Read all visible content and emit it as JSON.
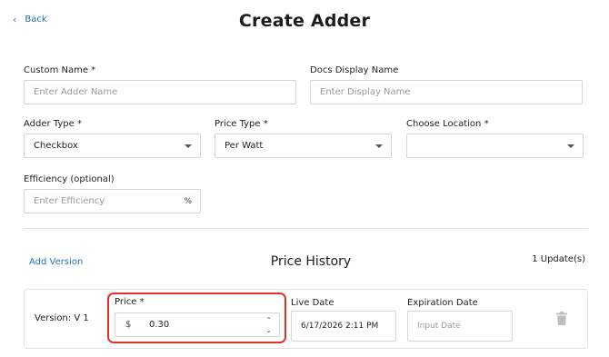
{
  "header": {
    "back_label": "Back",
    "title": "Create Adder"
  },
  "form": {
    "custom_name": {
      "label": "Custom Name *",
      "placeholder": "Enter Adder Name"
    },
    "docs_display_name": {
      "label": "Docs Display Name",
      "placeholder": "Enter Display Name"
    },
    "adder_type": {
      "label": "Adder Type *",
      "value": "Checkbox"
    },
    "price_type": {
      "label": "Price Type *",
      "value": "Per Watt"
    },
    "choose_location": {
      "label": "Choose Location *",
      "value": ""
    },
    "efficiency": {
      "label": "Efficiency (optional)",
      "placeholder": "Enter Efficiency",
      "suffix": "%"
    }
  },
  "price_history": {
    "add_version_label": "Add Version",
    "title": "Price History",
    "updates_count": "1 Update(s)",
    "versions": [
      {
        "version_label": "Version: V 1",
        "price_label": "Price *",
        "currency_symbol": "$",
        "price_value": "0.30",
        "live_date_label": "Live Date",
        "live_date_value": "6/17/2026 2:11 PM",
        "expiration_date_label": "Expiration Date",
        "expiration_date_placeholder": "Input Date"
      }
    ]
  },
  "colors": {
    "link": "#1e73be",
    "highlight": "#e0312a",
    "border": "#d6d6d6"
  },
  "icons": {
    "back": "chevron-left-icon",
    "dropdown": "caret-down-icon",
    "stepper": "stepper-arrows-icon",
    "delete": "trash-icon"
  }
}
